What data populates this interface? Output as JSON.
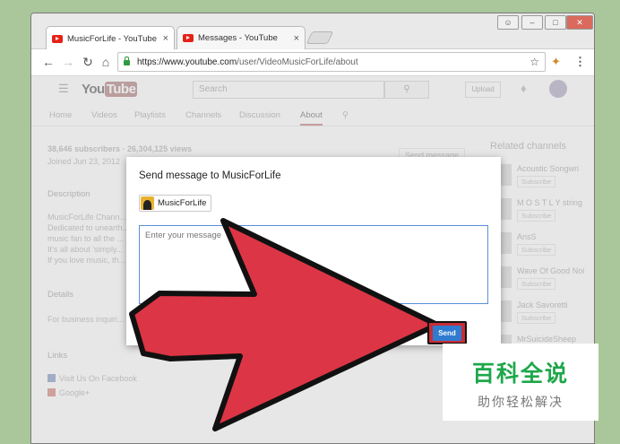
{
  "browser": {
    "tabs": [
      {
        "label": "MusicForLife - YouTube",
        "close": "×"
      },
      {
        "label": "Messages - YouTube",
        "close": "×"
      }
    ],
    "url_host": "https://www.youtube.com",
    "url_path": "/user/VideoMusicForLife/about"
  },
  "header": {
    "logo_you": "You",
    "logo_tube": "Tube",
    "search_placeholder": "Search",
    "upload_label": "Upload"
  },
  "channel_tabs": [
    "Home",
    "Videos",
    "Playlists",
    "Channels",
    "Discussion",
    "About"
  ],
  "about": {
    "stats": "38,646 subscribers · 26,304,125 views",
    "joined": "Joined Jun 23, 2012",
    "description_heading": "Description",
    "description_lines": [
      "MusicForLife Chann...",
      "Dedicated to unearth...",
      "music fan to all the ...",
      "It's all about 'simply...",
      "If you love music, th..."
    ],
    "details_heading": "Details",
    "business": "For business inquiri...",
    "links_heading": "Links",
    "link_facebook": "Visit Us On Facebook",
    "link_google": "Google+",
    "send_message_bg": "Send message"
  },
  "related": {
    "title": "Related channels",
    "subscribe_label": "Subscribe",
    "items": [
      {
        "name": "Acoustic Songwri"
      },
      {
        "name": "M O S T L Y string"
      },
      {
        "name": "AnsS"
      },
      {
        "name": "Wave Of Good Noi"
      },
      {
        "name": "Jack Savoretti"
      },
      {
        "name": "MrSuicideSheep"
      }
    ]
  },
  "dialog": {
    "title": "Send message to MusicForLife",
    "recipient": "MusicForLife",
    "message_placeholder": "Enter your message",
    "send_label": "Send"
  },
  "watermark": {
    "title": "百科全说",
    "subtitle": "助你轻松解决"
  },
  "colors": {
    "arrow_red": "#dc3545",
    "accent_blue": "#2f7bd0",
    "watermark_green": "#1ea74a"
  }
}
